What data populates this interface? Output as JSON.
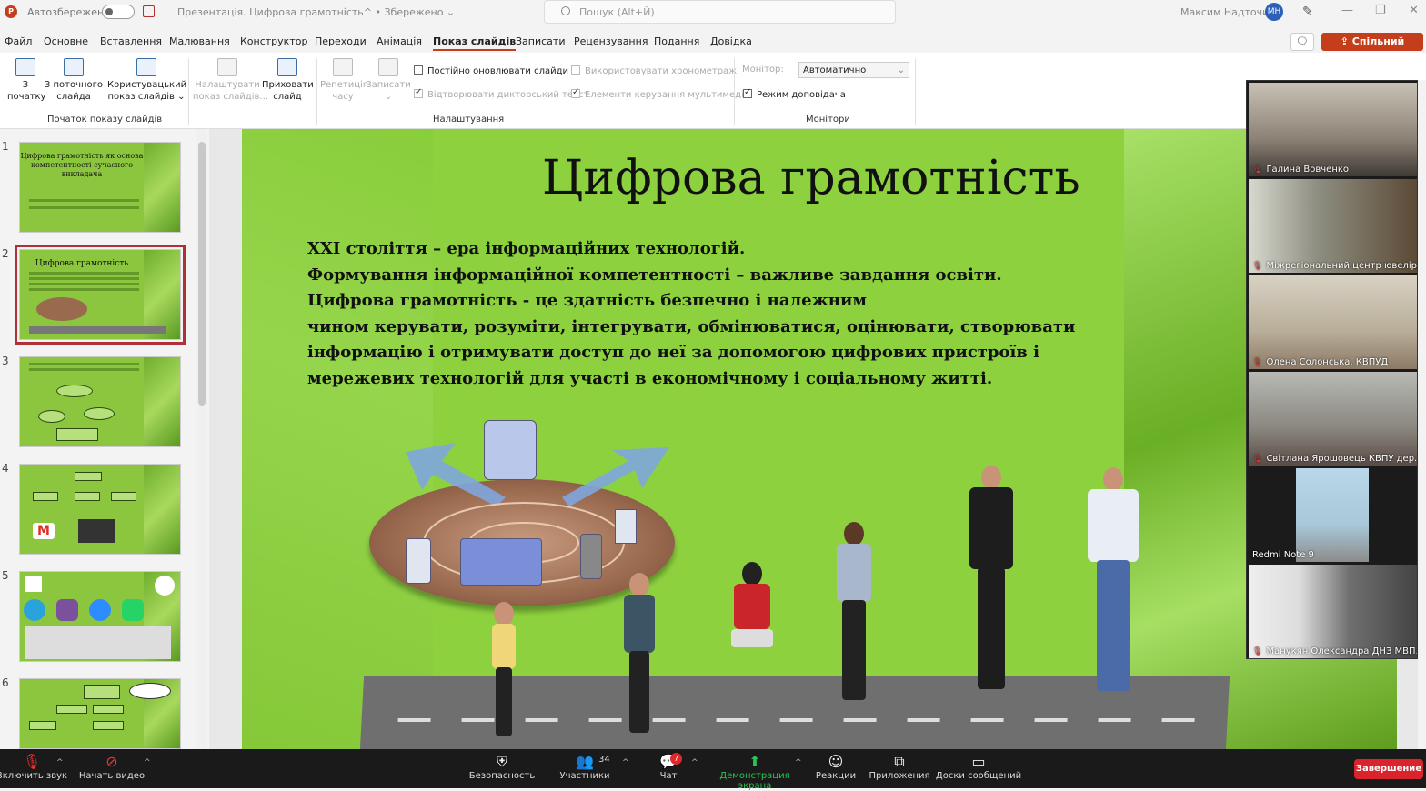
{
  "titlebar": {
    "autosave_label": "Автозбереження",
    "doc_title": "Презентація. Цифрова грамотність^ • Збережено ⌄",
    "search_placeholder": "Пошук (Alt+Й)",
    "user_name": "Максим Надточий",
    "user_initials": "МН"
  },
  "menu": {
    "items": [
      "Файл",
      "Основне",
      "Вставлення",
      "Малювання",
      "Конструктор",
      "Переходи",
      "Анімація",
      "Показ слайдів",
      "Записати",
      "Рецензування",
      "Подання",
      "Довідка"
    ],
    "active": "Показ слайдів",
    "share_label": "Спільний доступ"
  },
  "ribbon": {
    "btn_from_start": "З\nпочатку",
    "btn_from_current": "З поточного\nслайда",
    "btn_custom": "Користувацький\nпоказ слайдів ⌄",
    "group_start": "Початок показу слайдів",
    "btn_setup": "Налаштувати\nпоказ слайдів...",
    "btn_hide": "Приховати\nслайд",
    "btn_rehearse": "Репетиція\nчасу",
    "btn_record": "Записати\n⌄",
    "chk_update": "Постійно оновлювати слайди",
    "chk_narration": "Відтворювати дикторський текст",
    "chk_timings": "Використовувати хронометраж",
    "chk_media": "Елементи керування мультимедіа",
    "group_setup": "Налаштування",
    "monitor_label": "Монітор:",
    "monitor_value": "Автоматично",
    "chk_presenter": "Режим доповідача",
    "group_monitors": "Монітори"
  },
  "thumbnails": [
    {
      "num": "1",
      "title": "Цифрова грамотність як основа компетентності сучасного викладача"
    },
    {
      "num": "2",
      "title": "Цифрова грамотність"
    },
    {
      "num": "3",
      "title": ""
    },
    {
      "num": "4",
      "title": ""
    },
    {
      "num": "5",
      "title": ""
    },
    {
      "num": "6",
      "title": ""
    }
  ],
  "slide": {
    "title": "Цифрова грамотність",
    "lines": [
      "XXI століття – ера  інформаційних технологій.",
      "Формування інформаційної компетентності – важливе завдання освіти.",
      "Цифрова грамотність - це здатність безпечно і належним",
      "чином керувати, розуміти, інтегрувати, обмінюватися, оцінювати, створювати",
      "інформацію і отримувати доступ до неї за допомогою  цифрових пристроїв і",
      "мережевих технологій для участі в економічному і соціальному житті."
    ]
  },
  "participants": [
    {
      "name": "Галина Вовченко",
      "muted": true
    },
    {
      "name": "Міжрегіональний центр ювелір...",
      "muted": true
    },
    {
      "name": "Олена Солонська, КВПУД",
      "muted": true
    },
    {
      "name": "Світлана Ярошовець КВПУ дер...",
      "muted": true
    },
    {
      "name": "Redmi Note 9",
      "muted": false
    },
    {
      "name": "Манукян Олександра ДНЗ МВП...",
      "muted": true
    }
  ],
  "zoom": {
    "mute": "Включить звук",
    "video": "Начать видео",
    "security": "Безопасность",
    "participants": "Участники",
    "participants_count": "34",
    "chat": "Чат",
    "chat_badge": "7",
    "share": "Демонстрация экрана",
    "reactions": "Реакции",
    "apps": "Приложения",
    "whiteboards": "Доски сообщений",
    "end": "Завершение"
  },
  "colors": {
    "accent": "#c43e1c",
    "slide_green": "#8dd13f",
    "zoom_bar": "#1a1a1a",
    "end_red": "#d9242b",
    "share_green": "#29c552"
  }
}
